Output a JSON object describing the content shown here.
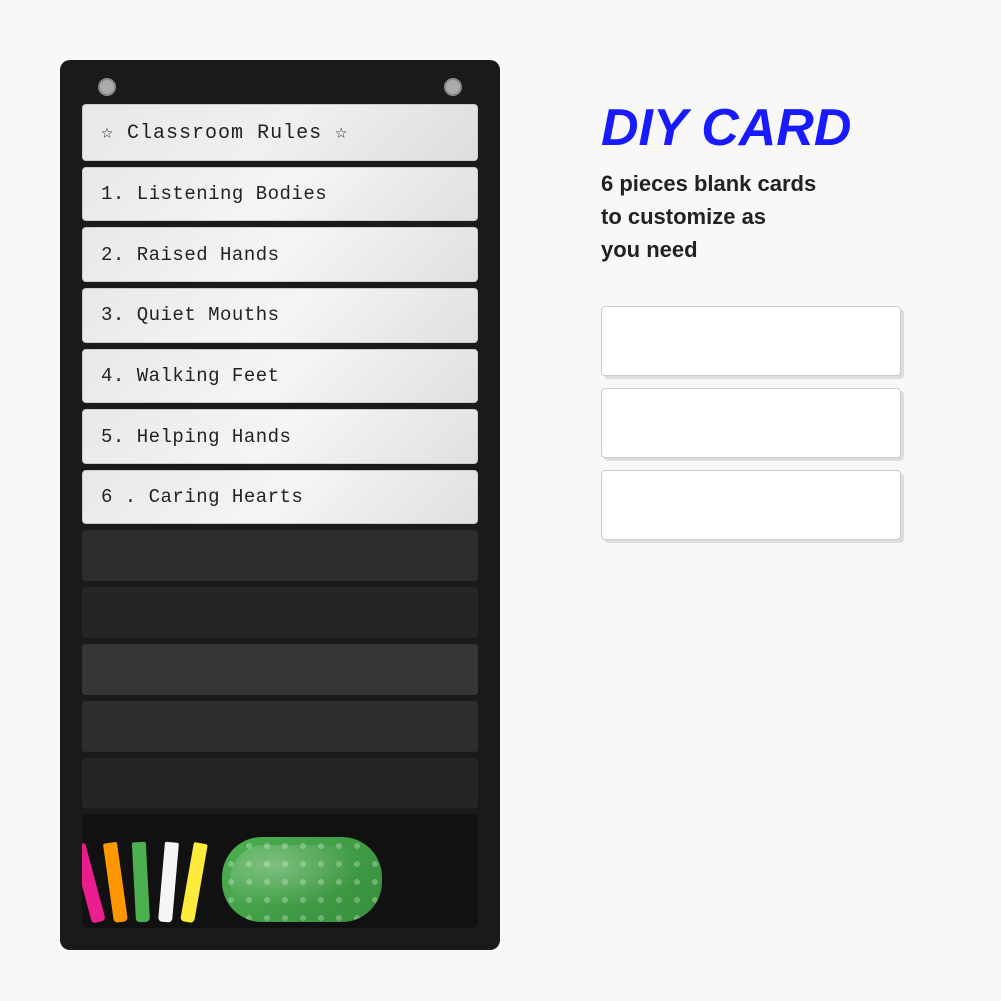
{
  "background": "#f8f8f8",
  "chart": {
    "title": "☆  Classroom Rules  ☆",
    "slots": [
      {
        "id": 1,
        "text": "1. Listening Bodies",
        "filled": true
      },
      {
        "id": 2,
        "text": "2. Raised Hands",
        "filled": true
      },
      {
        "id": 3,
        "text": "3. Quiet Mouths",
        "filled": true
      },
      {
        "id": 4,
        "text": "4. Walking Feet",
        "filled": true
      },
      {
        "id": 5,
        "text": "5. Helping Hands",
        "filled": true
      },
      {
        "id": 6,
        "text": "6 . Caring Hearts",
        "filled": true
      }
    ],
    "empty_slots": 5,
    "grommets": [
      "left",
      "right"
    ]
  },
  "diy": {
    "title": "DIY CARD",
    "description_line1": "6 pieces blank cards",
    "description_line2": "to customize as",
    "description_line3": "you need",
    "blank_cards_count": 3
  },
  "markers": [
    {
      "color": "#e91e8c",
      "label": "pink-marker"
    },
    {
      "color": "#ff9800",
      "label": "orange-marker"
    },
    {
      "color": "#4caf50",
      "label": "green-marker"
    },
    {
      "color": "#f5f5f5",
      "label": "white-marker"
    },
    {
      "color": "#ffeb3b",
      "label": "yellow-marker"
    }
  ]
}
